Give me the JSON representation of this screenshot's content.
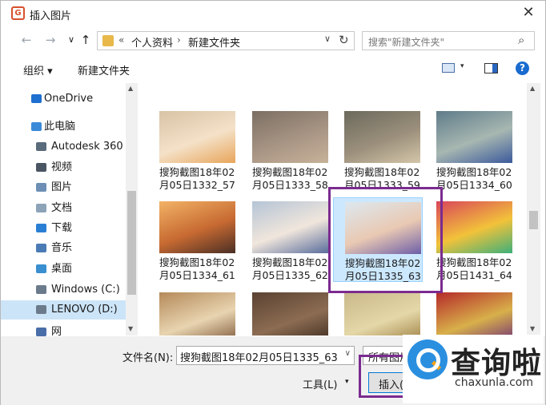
{
  "window": {
    "title": "插入图片",
    "close_glyph": "✕"
  },
  "nav": {
    "back": "←",
    "forward": "→",
    "up": "↑"
  },
  "address": {
    "chevrons": "«",
    "crumb1": "个人资料",
    "separator": "›",
    "crumb2": "新建文件夹",
    "dropdown": "∨",
    "refresh": "↻"
  },
  "search": {
    "placeholder": "搜索\"新建文件夹\"",
    "icon": "search-icon"
  },
  "toolbar": {
    "organize": "组织 ▾",
    "new_folder": "新建文件夹",
    "view_caret": "▾",
    "help": "?"
  },
  "sidebar": {
    "items": [
      {
        "label": "OneDrive",
        "icon_color": "#1e6fd0"
      },
      {
        "label": "此电脑",
        "icon_color": "#3b8ad9"
      },
      {
        "label": "Autodesk 360",
        "icon_color": "#5a6b7c"
      },
      {
        "label": "视频",
        "icon_color": "#4a5563"
      },
      {
        "label": "图片",
        "icon_color": "#6d8fb5"
      },
      {
        "label": "文档",
        "icon_color": "#8da3b8"
      },
      {
        "label": "下载",
        "icon_color": "#2a7fd4"
      },
      {
        "label": "音乐",
        "icon_color": "#4b7bb5"
      },
      {
        "label": "桌面",
        "icon_color": "#3a8fd0"
      },
      {
        "label": "Windows (C:)",
        "icon_color": "#6b7b8b"
      },
      {
        "label": "LENOVO (D:)",
        "icon_color": "#6b7b8b"
      },
      {
        "label": "网",
        "icon_color": "#4a6ea8"
      }
    ],
    "selected_index": 10
  },
  "files": [
    {
      "line1": "搜狗截图18年02",
      "line2": "月05日1332_57",
      "colors": [
        "#d8c3a5",
        "#f4e1c8",
        "#e8a55a"
      ]
    },
    {
      "line1": "搜狗截图18年02",
      "line2": "月05日1333_58",
      "colors": [
        "#7b6f63",
        "#a89584",
        "#c7b299"
      ]
    },
    {
      "line1": "搜狗截图18年02",
      "line2": "月05日1333_59",
      "colors": [
        "#6b6a5c",
        "#9b8f7c",
        "#d4c6a8"
      ]
    },
    {
      "line1": "搜狗截图18年02",
      "line2": "月05日1334_60",
      "colors": [
        "#5f7c8a",
        "#a7b7b1",
        "#3c5a9c"
      ]
    },
    {
      "line1": "搜狗截图18年02",
      "line2": "月05日1334_61",
      "colors": [
        "#f2b366",
        "#c76a32",
        "#4a2e24"
      ]
    },
    {
      "line1": "搜狗截图18年02",
      "line2": "月05日1335_62",
      "colors": [
        "#b5c4d6",
        "#f0e6dc",
        "#5a6d9c"
      ]
    },
    {
      "line1": "搜狗截图18年02",
      "line2": "月05日1335_63",
      "colors": [
        "#dde8ef",
        "#e9c9b3",
        "#6d5ea8"
      ]
    },
    {
      "line1": "搜狗截图18年02",
      "line2": "月05日1431_64",
      "colors": [
        "#d9455a",
        "#f2c23a",
        "#3db07a"
      ]
    },
    {
      "line1": "",
      "line2": "",
      "colors": [
        "#b58a5a",
        "#e8d4b0",
        "#7a5234"
      ]
    },
    {
      "line1": "",
      "line2": "",
      "colors": [
        "#5a4232",
        "#8c6c52",
        "#3a2a1e"
      ]
    },
    {
      "line1": "",
      "line2": "",
      "colors": [
        "#c9b88a",
        "#e4d7a8",
        "#9a7a3c"
      ]
    },
    {
      "line1": "",
      "line2": "",
      "colors": [
        "#b52a2a",
        "#d8b04a",
        "#6a2a7a"
      ]
    }
  ],
  "selected_file_index": 6,
  "bottom": {
    "filename_label": "文件名(N):",
    "filename_value": "搜狗截图18年02月05日1335_63",
    "filetype_value": "所有图片",
    "tools_label": "工具(L)",
    "tools_caret": "▾",
    "insert_label": "插入(S)"
  },
  "watermark": {
    "big": "查询啦",
    "small": "chaxunla.com"
  },
  "colors": {
    "highlight": "#7b2b8f",
    "accent": "#0078d7"
  }
}
